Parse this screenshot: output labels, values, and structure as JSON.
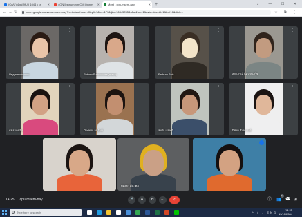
{
  "browser": {
    "tabs": [
      {
        "label": "(Cu/U) 4bnl 9fU ( 1044 ) kn",
        "icon_color": "#1a73e8",
        "active": false
      },
      {
        "label": "4ON Ilbnnum nm CM ilbnnm",
        "icon_color": "#ea4335",
        "active": false
      },
      {
        "label": "Meet - cpu-msem-nay",
        "icon_color": "#188038",
        "active": true
      }
    ],
    "new_tab_glyph": "+",
    "window_controls": [
      "⌄",
      "—",
      "☐",
      "✕"
    ],
    "url": "meet.google.com/cpu-msem-nay?hl=th&authuser=0&pli=1&hs=179&ijlm=1634578534&adhoc=1&avtc=1&ccid=1&bwf=1&dtbf=1",
    "nav": {
      "back": "←",
      "forward": "→",
      "reload": "↻"
    },
    "toolbar_icons": [
      "☆",
      "⧉",
      "⋮"
    ]
  },
  "participants": [
    {
      "name": "Vayyam nkumnh",
      "row": 1,
      "col": 1,
      "skin": "#e9c4a8",
      "hair": "#2a1b14",
      "shirt": "#c9d6e0",
      "bg": "#6b6866"
    },
    {
      "name": "Pakorn Suthanburai(mana)",
      "row": 1,
      "col": 2,
      "skin": "#d9a88a",
      "hair": "#1e1512",
      "shirt": "#dfe3e6",
      "bg": "#b7b2ae"
    },
    {
      "name": "Pathum Pois",
      "row": 1,
      "col": 3,
      "skin": "#f3e4c9",
      "hair": "#3a2e24",
      "shirt": "#2f2a24",
      "bg": "#575149"
    },
    {
      "name": "สุภาภรณ์ นิ่มประเสริฐ",
      "row": 1,
      "col": 4,
      "skin": "#c29b80",
      "hair": "#30241c",
      "shirt": "#7b8584",
      "bg": "#9b9891"
    },
    {
      "name": "ฉัตร งามยิ่ง",
      "row": 2,
      "col": 1,
      "skin": "#d2a184",
      "hair": "#1a1210",
      "shirt": "#d94a7e",
      "bg": "#e2d4bc"
    },
    {
      "name": "ปิยะพงษ์ อนุรักษ์",
      "row": 2,
      "col": 2,
      "skin": "#c28f70",
      "hair": "#1c1410",
      "shirt": "#d3d7d9",
      "bg": "#9a7250"
    },
    {
      "name": "สมใจ แสงศรี",
      "row": 2,
      "col": 3,
      "skin": "#c7977a",
      "hair": "#211713",
      "shirt": "#3b4f6a",
      "bg": "#bfc4be"
    },
    {
      "name": "นิตยา จันทรวงศ์",
      "row": 2,
      "col": 4,
      "skin": "#e0b79a",
      "hair": "#1b1412",
      "shirt": "#efeff0",
      "bg": "#efefef"
    },
    {
      "name": "",
      "row": 3,
      "col": 1,
      "skin": "#d8a888",
      "hair": "#1b1412",
      "shirt": "#e8643a",
      "bg": "#d8d3cc"
    },
    {
      "name": "ทองสุก มีนาคม",
      "row": 3,
      "col": 2,
      "skin": "#caa086",
      "hair": "#e0b020",
      "shirt": "#38424c",
      "bg": "#5d5f61"
    },
    {
      "name": "",
      "row": 3,
      "col": 3,
      "skin": "#d3a282",
      "hair": "#151010",
      "shirt": "#e06a2e",
      "bg": "#3e7fa6",
      "speaking": true
    }
  ],
  "meeting": {
    "time": "14:25",
    "separator": "|",
    "code": "cpu-msem-nay"
  },
  "controls": [
    {
      "id": "mic",
      "glyph": "🎤"
    },
    {
      "id": "camera",
      "glyph": "⏺"
    },
    {
      "id": "captions",
      "glyph": "⧉"
    },
    {
      "id": "present",
      "glyph": "⋯"
    },
    {
      "id": "end",
      "glyph": "✆"
    }
  ],
  "right_controls": {
    "info": "ⓘ",
    "people": "👥",
    "people_count": "11",
    "chat": "💬",
    "activities": "⊞"
  },
  "taskbar": {
    "search_placeholder": "Type here to search",
    "apps": [
      {
        "name": "task-view",
        "color": "#ffffff"
      },
      {
        "name": "edge",
        "color": "#1f9be0"
      },
      {
        "name": "file-explorer",
        "color": "#f4c430"
      },
      {
        "name": "store",
        "color": "#ffffff"
      },
      {
        "name": "mail",
        "color": "#4a90d9"
      },
      {
        "name": "chrome",
        "color": "#34a853"
      },
      {
        "name": "word",
        "color": "#2b5797"
      },
      {
        "name": "excel",
        "color": "#1e7145"
      },
      {
        "name": "powerpoint",
        "color": "#d24726"
      },
      {
        "name": "line",
        "color": "#00c300"
      }
    ],
    "tray_icons": "^ ⌂ ♪ ENG",
    "clock": {
      "time": "14:25",
      "date": "19/10/2564"
    }
  }
}
